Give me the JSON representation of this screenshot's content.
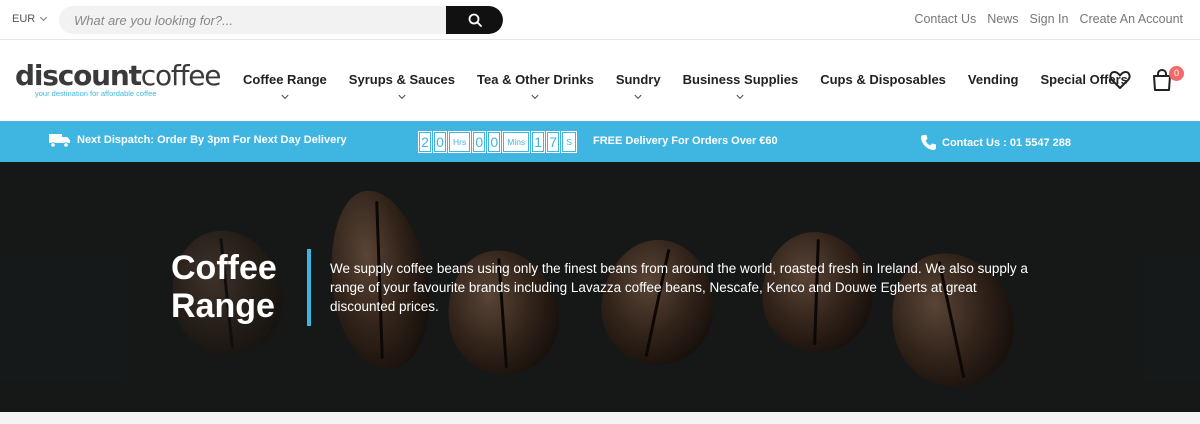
{
  "topbar": {
    "currency": "EUR",
    "search_placeholder": "What are you looking for?...",
    "links": [
      "Contact Us",
      "News",
      "Sign In",
      "Create An Account"
    ]
  },
  "logo": {
    "bold": "discount",
    "light": "coffee",
    "tagline": "your destination for affordable coffee"
  },
  "nav": [
    {
      "label": "Coffee Range",
      "dropdown": true
    },
    {
      "label": "Syrups & Sauces",
      "dropdown": true
    },
    {
      "label": "Tea & Other Drinks",
      "dropdown": true
    },
    {
      "label": "Sundry",
      "dropdown": true
    },
    {
      "label": "Business Supplies",
      "dropdown": true
    },
    {
      "label": "Cups & Disposables",
      "dropdown": false
    },
    {
      "label": "Vending",
      "dropdown": false
    },
    {
      "label": "Special Offers",
      "dropdown": false
    }
  ],
  "cart": {
    "count": "0"
  },
  "infobar": {
    "dispatch": "Next Dispatch:  Order By 3pm For Next Day Delivery",
    "countdown": {
      "hours": [
        "2",
        "0"
      ],
      "hrs_label": "Hrs",
      "mins": [
        "0",
        "0"
      ],
      "mins_label": "Mins",
      "secs": [
        "1",
        "7"
      ],
      "secs_label": "S"
    },
    "delivery": "FREE Delivery For Orders Over €60",
    "contact": "Contact Us : 01 5547 288"
  },
  "hero": {
    "title_line1": "Coffee",
    "title_line2": "Range",
    "description": "We supply coffee beans using only the finest beans from around the world, roasted fresh in Ireland. We also supply a range of your favourite brands including Lavazza coffee beans, Nescafe, Kenco and Douwe Egberts at great discounted prices."
  },
  "colors": {
    "accent": "#3fb6e2",
    "dark": "#111111",
    "badge": "#f26b6b"
  }
}
